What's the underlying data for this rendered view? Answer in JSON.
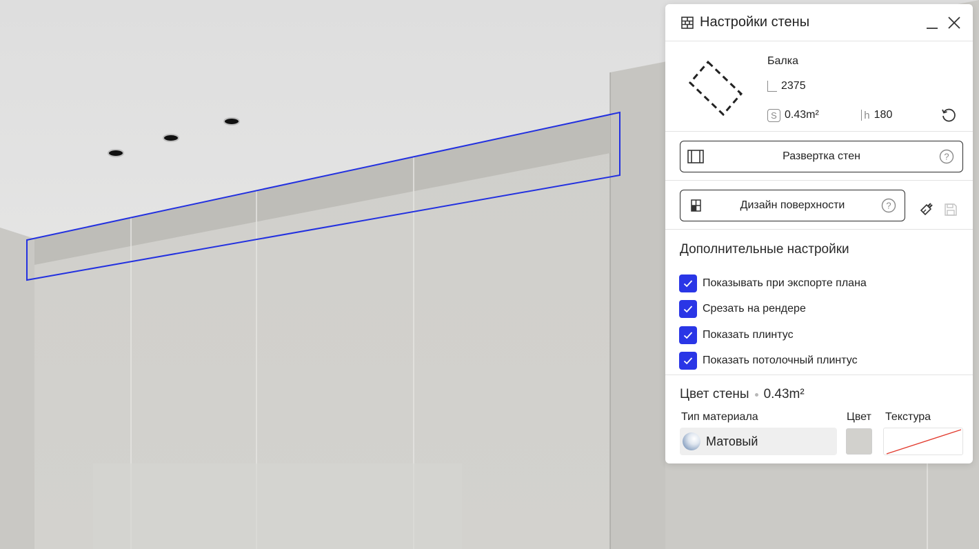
{
  "panel": {
    "title": "Настройки стены"
  },
  "info": {
    "type": "Балка",
    "length_label": "L",
    "length": "2375",
    "area_label": "S",
    "area": "0.43m²",
    "height_label": "h",
    "height": "180"
  },
  "buttons": {
    "unfold": "Развертка стен",
    "surface_design": "Дизайн поверхности"
  },
  "extra": {
    "title": "Дополнительные настройки",
    "options": [
      {
        "label": "Показывать при экспорте плана",
        "checked": true
      },
      {
        "label": "Срезать на рендере",
        "checked": true
      },
      {
        "label": "Показать плинтус",
        "checked": true
      },
      {
        "label": "Показать потолочный плинтус",
        "checked": true
      }
    ]
  },
  "wall_color": {
    "title": "Цвет стены",
    "area": "0.43m²",
    "material_type_label": "Тип материала",
    "color_label": "Цвет",
    "texture_label": "Текстура",
    "material_value": "Матовый",
    "swatch_color": "#d2d1cd"
  },
  "colors": {
    "accent": "#2a36e6",
    "selection_outline": "#2230e0"
  },
  "icons": {
    "panel": "wall-grid-icon",
    "minimize": "minimize-icon",
    "close": "close-icon",
    "reset": "reset-icon",
    "unfold": "wall-unfold-icon",
    "design": "surface-design-icon",
    "help": "help-icon",
    "brush": "brush-icon",
    "save": "save-icon"
  }
}
